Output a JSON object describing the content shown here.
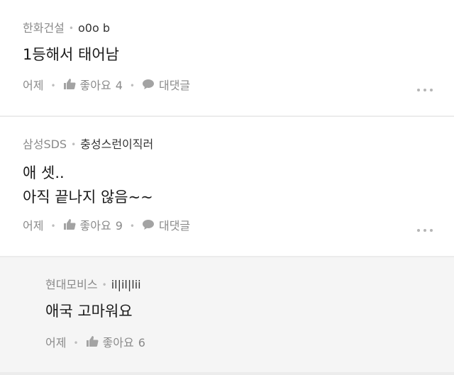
{
  "comments": [
    {
      "company": "한화건설",
      "nickname": "o0o b",
      "text_lines": [
        "1등해서 태어남"
      ],
      "time": "어제",
      "like_label": "좋아요",
      "like_count": "4",
      "reply_label": "대댓글"
    },
    {
      "company": "삼성SDS",
      "nickname": "충성스런이직러",
      "text_lines": [
        "애 셋..",
        "아직 끝나지 않음~~"
      ],
      "time": "어제",
      "like_label": "좋아요",
      "like_count": "9",
      "reply_label": "대댓글"
    }
  ],
  "reply": {
    "company": "현대모비스",
    "nickname": "il|il|lii",
    "text_lines": [
      "애국 고마워요"
    ],
    "time": "어제",
    "like_label": "좋아요",
    "like_count": "6"
  },
  "icons": {
    "like": "thumbs-up-icon",
    "reply": "speech-bubble-icon",
    "more": "more-dots-icon"
  },
  "colors": {
    "meta_gray": "#8a8a8a",
    "background": "#ececec",
    "reply_background": "#f5f5f5"
  }
}
